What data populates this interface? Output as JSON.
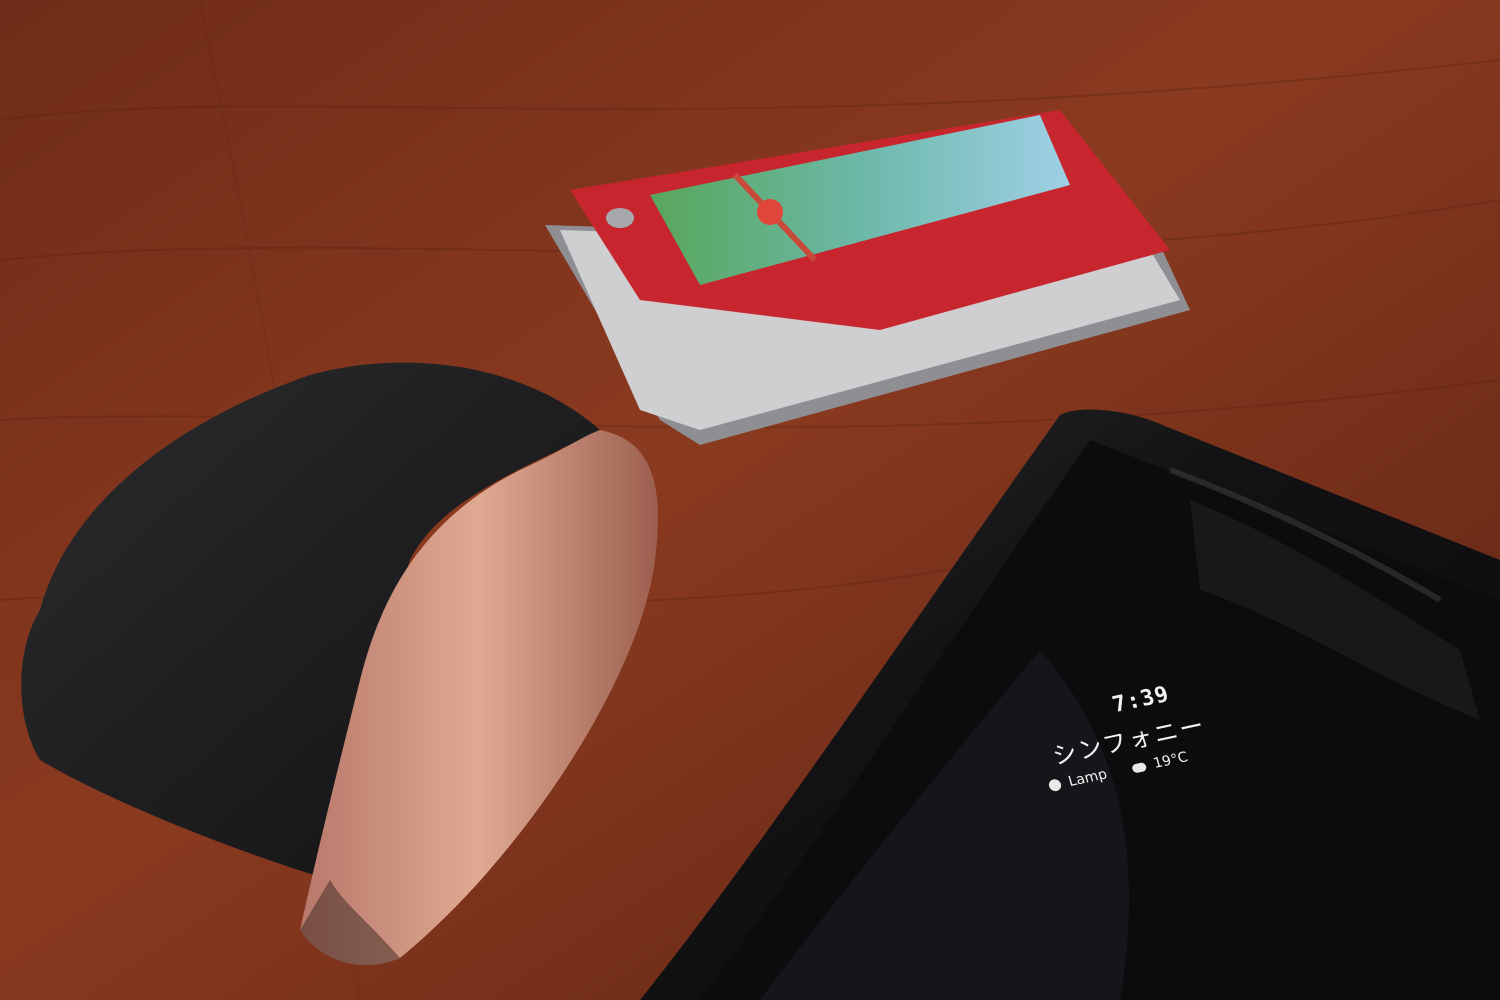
{
  "photo": {
    "objects": [
      "wooden-table",
      "earbuds-charging-case",
      "card-wallet",
      "smartphone"
    ]
  },
  "phone_screen": {
    "time": "7:39",
    "track": "シンフォニー",
    "app_label": "Lamp",
    "temperature": "19°C"
  },
  "colors": {
    "table": "#7a3019",
    "case_body": "#1f1f21",
    "case_band": "#c9907a",
    "wallet": "#c8262e",
    "phone": "#141416"
  }
}
